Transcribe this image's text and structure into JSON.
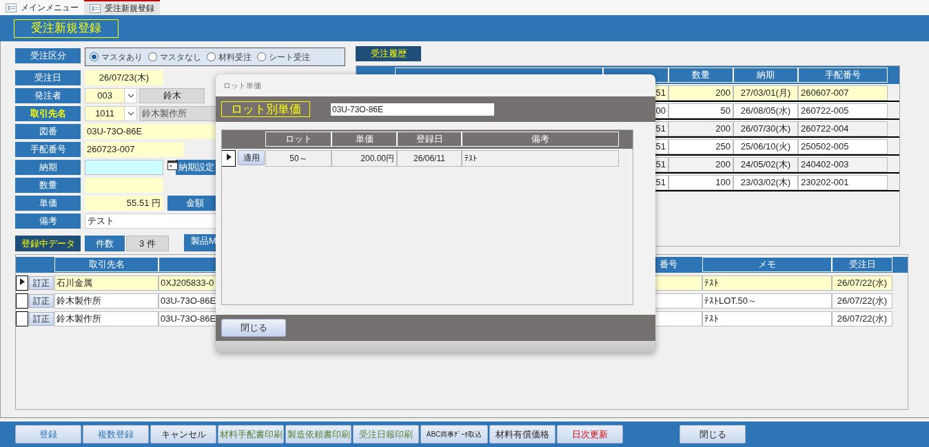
{
  "tabs": [
    {
      "label": "メインメニュー",
      "selected": false
    },
    {
      "label": "受注新規登録",
      "selected": true
    }
  ],
  "form_title": "受注新規登録",
  "order_type": {
    "label": "受注区分",
    "options": [
      {
        "label": "マスタあり",
        "selected": true
      },
      {
        "label": "マスタなし",
        "selected": false
      },
      {
        "label": "材料受注",
        "selected": false
      },
      {
        "label": "シート受注",
        "selected": false
      }
    ]
  },
  "fields": [
    {
      "label": "受注日",
      "kind": "date",
      "highlight": false,
      "value": "26/07/23(木)"
    },
    {
      "label": "発注者",
      "kind": "combo",
      "highlight": false,
      "value": "003",
      "name": "鈴木"
    },
    {
      "label": "取引先名",
      "kind": "combo_wide",
      "highlight": true,
      "value": "1011",
      "name": "鈴木製作所"
    },
    {
      "label": "図番",
      "kind": "wide",
      "highlight": false,
      "value": "03U-73O-86E"
    },
    {
      "label": "手配番号",
      "kind": "medium",
      "highlight": false,
      "value": "260723-007"
    },
    {
      "label": "納期",
      "kind": "calendar",
      "highlight": false,
      "button": "納期設定"
    },
    {
      "label": "数量",
      "kind": "number",
      "highlight": false
    },
    {
      "label": "単価",
      "kind": "price",
      "highlight": false,
      "value": "55.51 円",
      "button": "金額"
    },
    {
      "label": "備考",
      "kind": "memo",
      "highlight": false,
      "value": "テスト"
    }
  ],
  "registered": {
    "label": "登録中データ",
    "count_label": "件数",
    "count": "3 件",
    "button": "製品M"
  },
  "history": {
    "title": "受注履歴",
    "columns": [
      "数量",
      "納期",
      "手配番号"
    ],
    "rows": [
      {
        "unit_price": "51",
        "quantity": "200",
        "due": "27/03/01(月)",
        "arrangement_no": "260607-007",
        "selected": true
      },
      {
        "unit_price": "00",
        "quantity": "50",
        "due": "26/08/05(水)",
        "arrangement_no": "260722-005",
        "selected": false
      },
      {
        "unit_price": "51",
        "quantity": "200",
        "due": "26/07/30(木)",
        "arrangement_no": "260722-004",
        "selected": false
      },
      {
        "unit_price": "51",
        "quantity": "250",
        "due": "25/06/10(火)",
        "arrangement_no": "250502-005",
        "selected": false
      },
      {
        "unit_price": "51",
        "quantity": "200",
        "due": "24/05/02(木)",
        "arrangement_no": "240402-003",
        "selected": false
      },
      {
        "unit_price": "51",
        "quantity": "100",
        "due": "23/03/02(木)",
        "arrangement_no": "230202-001",
        "selected": false
      }
    ]
  },
  "orders": {
    "columns": [
      "取引先名",
      "番号",
      "メモ",
      "受注日"
    ],
    "rows": [
      {
        "action": "訂正",
        "client": "石川金属",
        "drawing_no": "0XJ205833-0",
        "memo": "ﾃｽﾄ",
        "order_date": "26/07/22(水)",
        "selected": true
      },
      {
        "action": "訂正",
        "client": "鈴木製作所",
        "drawing_no": "03U-73O-86E",
        "memo": "ﾃｽﾄLOT.50～",
        "order_date": "26/07/22(水)",
        "selected": false
      },
      {
        "action": "訂正",
        "client": "鈴木製作所",
        "drawing_no": "03U-73O-86E",
        "memo": "ﾃｽﾄ",
        "order_date": "26/07/22(水)",
        "selected": false
      }
    ]
  },
  "dialog": {
    "title": "ロット単価",
    "heading": "ロット別単価",
    "drawing_no": "03U-73O-86E",
    "columns": [
      "ロット",
      "単価",
      "登録日",
      "備考"
    ],
    "rows": [
      {
        "action": "適用",
        "lot": "50～",
        "price": "200.00円",
        "date": "26/06/11",
        "note": "ﾃｽﾄ",
        "selected": true
      }
    ],
    "close": "閉じる"
  },
  "buttons": [
    {
      "label": "登録",
      "kind": "entry"
    },
    {
      "label": "複数登録",
      "kind": "entry"
    },
    {
      "label": "キャンセル",
      "kind": "plain"
    },
    {
      "label": "材料手配書印刷",
      "kind": "print"
    },
    {
      "label": "製造依頼書印刷",
      "kind": "print"
    },
    {
      "label": "受注日報印刷",
      "kind": "print"
    },
    {
      "label": "ABC商事ﾃﾞｰﾀ取込",
      "kind": "plain"
    },
    {
      "label": "材料有償価格",
      "kind": "plain"
    },
    {
      "label": "日次更新",
      "kind": "update"
    },
    {
      "label": "閉じる",
      "kind": "plain"
    }
  ]
}
